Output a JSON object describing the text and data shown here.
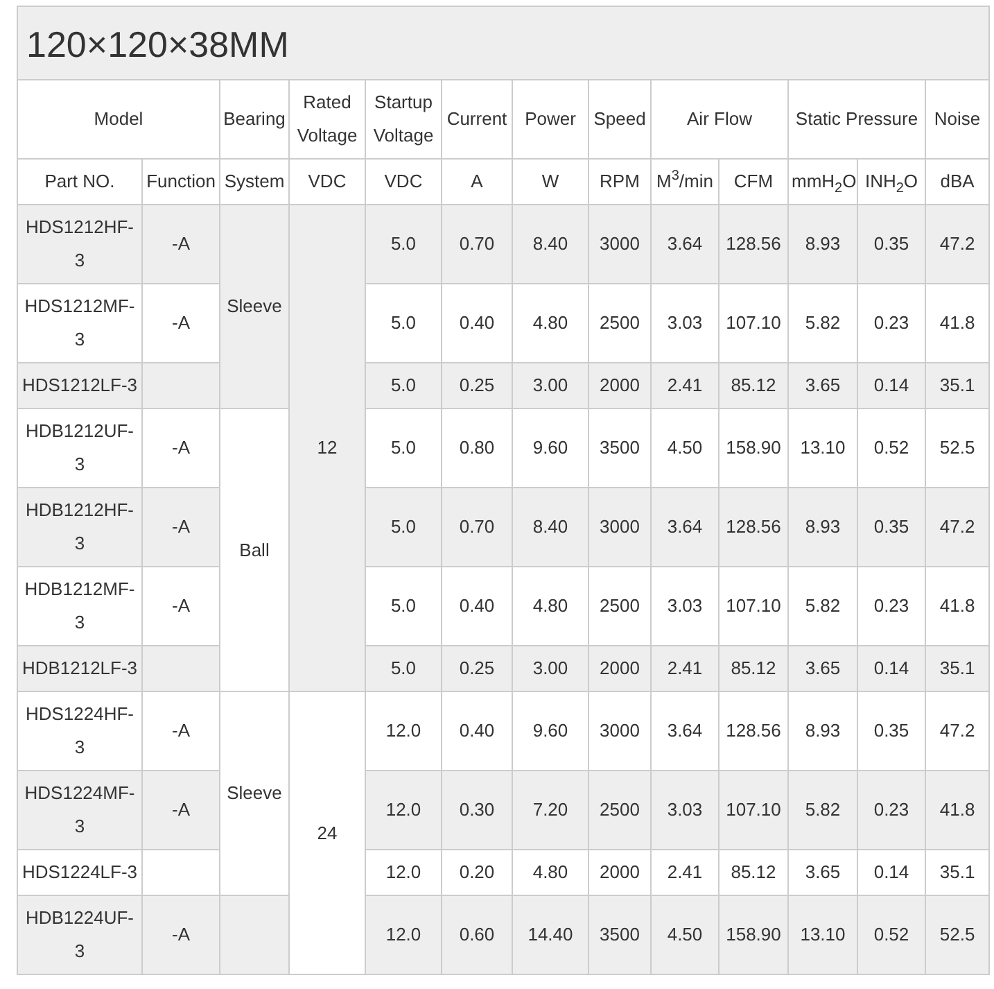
{
  "title": "120×120×38MM",
  "columns": [
    {
      "group": "Model",
      "units": [
        "Part NO.",
        "Function"
      ]
    },
    {
      "group": "Bearing",
      "units": [
        "System"
      ]
    },
    {
      "group": "Rated Voltage",
      "units": [
        "VDC"
      ]
    },
    {
      "group": "Startup Voltage",
      "units": [
        "VDC"
      ]
    },
    {
      "group": "Current",
      "units": [
        "A"
      ]
    },
    {
      "group": "Power",
      "units": [
        "W"
      ]
    },
    {
      "group": "Speed",
      "units": [
        "RPM"
      ]
    },
    {
      "group": "Air Flow",
      "units": [
        "M$^{3}$/min",
        "CFM"
      ]
    },
    {
      "group": "Static Pressure",
      "units": [
        "mmH$_{2}$O",
        "INH$_{2}$O"
      ]
    },
    {
      "group": "Noise",
      "units": [
        "dBA"
      ]
    }
  ],
  "voltage_groups": [
    {
      "voltage": "12",
      "bearing_groups": [
        {
          "bearing": "Sleeve",
          "rows": [
            {
              "part_no": "HDS1212HF-3",
              "function": "-A",
              "values": [
                "5.0",
                "0.70",
                "8.40",
                "3000",
                "3.64",
                "128.56",
                "8.93",
                "0.35",
                "47.2"
              ]
            },
            {
              "part_no": "HDS1212MF-3",
              "function": "-A",
              "values": [
                "5.0",
                "0.40",
                "4.80",
                "2500",
                "3.03",
                "107.10",
                "5.82",
                "0.23",
                "41.8"
              ]
            },
            {
              "part_no": "HDS1212LF-3",
              "values": [
                "5.0",
                "0.25",
                "3.00",
                "2000",
                "2.41",
                "85.12",
                "3.65",
                "0.14",
                "35.1"
              ]
            }
          ]
        },
        {
          "bearing": "Ball",
          "rows": [
            {
              "part_no": "HDB1212UF-3",
              "function": "-A",
              "values": [
                "5.0",
                "0.80",
                "9.60",
                "3500",
                "4.50",
                "158.90",
                "13.10",
                "0.52",
                "52.5"
              ]
            },
            {
              "part_no": "HDB1212HF-3",
              "function": "-A",
              "values": [
                "5.0",
                "0.70",
                "8.40",
                "3000",
                "3.64",
                "128.56",
                "8.93",
                "0.35",
                "47.2"
              ]
            },
            {
              "part_no": "HDB1212MF-3",
              "function": "-A",
              "values": [
                "5.0",
                "0.40",
                "4.80",
                "2500",
                "3.03",
                "107.10",
                "5.82",
                "0.23",
                "41.8"
              ]
            },
            {
              "part_no": "HDB1212LF-3",
              "values": [
                "5.0",
                "0.25",
                "3.00",
                "2000",
                "2.41",
                "85.12",
                "3.65",
                "0.14",
                "35.1"
              ]
            }
          ]
        }
      ]
    },
    {
      "voltage": "24",
      "bearing_groups": [
        {
          "bearing": "Sleeve",
          "rows": [
            {
              "part_no": "HDS1224HF-3",
              "function": "-A",
              "values": [
                "12.0",
                "0.40",
                "9.60",
                "3000",
                "3.64",
                "128.56",
                "8.93",
                "0.35",
                "47.2"
              ]
            },
            {
              "part_no": "HDS1224MF-3",
              "function": "-A",
              "values": [
                "12.0",
                "0.30",
                "7.20",
                "2500",
                "3.03",
                "107.10",
                "5.82",
                "0.23",
                "41.8"
              ]
            },
            {
              "part_no": "HDS1224LF-3",
              "values": [
                "12.0",
                "0.20",
                "4.80",
                "2000",
                "2.41",
                "85.12",
                "3.65",
                "0.14",
                "35.1"
              ]
            }
          ]
        },
        {
          "rows": [
            {
              "part_no": "HDB1224UF-3",
              "function": "-A",
              "values": [
                "12.0",
                "0.60",
                "14.40",
                "3500",
                "4.50",
                "158.90",
                "13.10",
                "0.52",
                "52.5"
              ]
            }
          ]
        }
      ]
    }
  ]
}
